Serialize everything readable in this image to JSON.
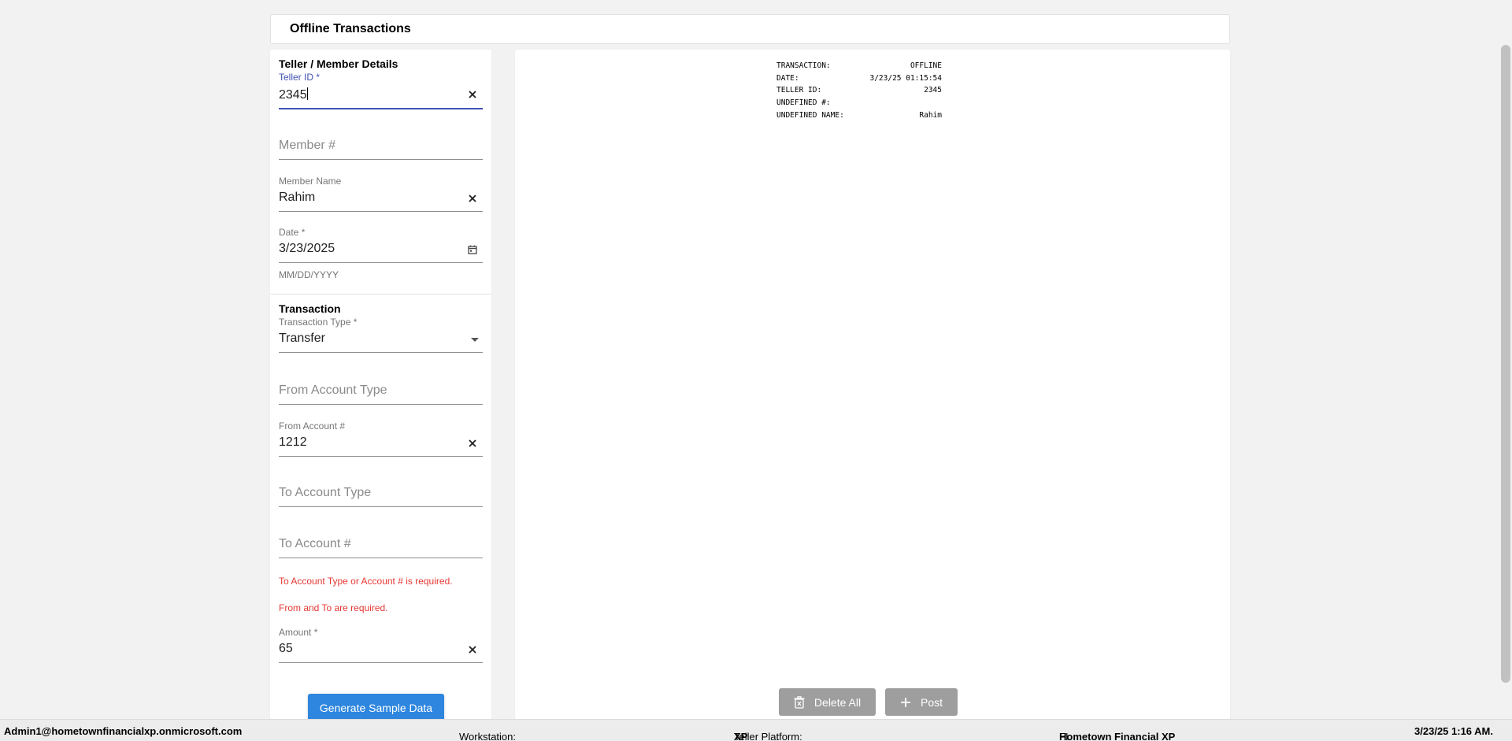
{
  "page": {
    "title": "Offline Transactions"
  },
  "member_section": {
    "title": "Teller / Member Details",
    "teller_id": {
      "label": "Teller ID",
      "required_mark": "*",
      "value": "2345"
    },
    "member_number": {
      "placeholder": "Member #"
    },
    "member_name": {
      "label": "Member Name",
      "value": "Rahim"
    },
    "date": {
      "label": "Date",
      "required_mark": "*",
      "value": "3/23/2025",
      "hint": "MM/DD/YYYY"
    }
  },
  "transaction_section": {
    "title": "Transaction",
    "transaction_type": {
      "label": "Transaction Type",
      "required_mark": "*",
      "value": "Transfer"
    },
    "from_account_type": {
      "placeholder": "From Account Type"
    },
    "from_account_number": {
      "label": "From Account #",
      "value": "1212"
    },
    "to_account_type": {
      "placeholder": "To Account Type"
    },
    "to_account_number": {
      "placeholder": "To Account #"
    },
    "errors": [
      "To Account Type or Account # is required.",
      "From and To are required."
    ],
    "amount": {
      "label": "Amount",
      "required_mark": "*",
      "value": "65"
    },
    "generate_button": "Generate Sample Data"
  },
  "receipt": {
    "rows": [
      {
        "key": "TRANSACTION:",
        "value": "OFFLINE"
      },
      {
        "key": "DATE:",
        "value": "3/23/25 01:15:54"
      },
      {
        "key": "TELLER ID:",
        "value": "2345"
      },
      {
        "key": "UNDEFINED #:",
        "value": ""
      },
      {
        "key": "UNDEFINED NAME:",
        "value": "Rahim"
      }
    ]
  },
  "actions": {
    "delete_all": "Delete All",
    "post": "Post"
  },
  "status_bar": {
    "user": "Admin1@hometownfinancialxp.onmicrosoft.com",
    "workstation_label": "Workstation:",
    "workstation_value": "",
    "platform_label": "Teller Platform:",
    "platform_value": "XP",
    "fi_label": "FI:",
    "fi_value": "Hometown Financial XP",
    "datetime": "3/23/25 1:16 AM."
  },
  "colors": {
    "focus": "#3f51b5",
    "error": "#e53935",
    "primary_button": "#2e86de",
    "disabled_button": "#9e9e9e"
  }
}
